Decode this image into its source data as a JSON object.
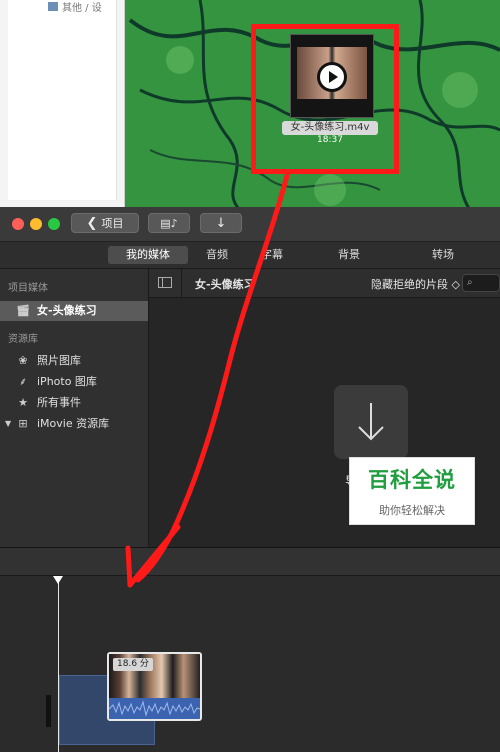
{
  "finder": {
    "top_text": "其他 / 设"
  },
  "desktop_file": {
    "name": "女-头像练习.m4v",
    "duration": "18:37"
  },
  "window": {
    "back_button": "项目",
    "back_icon": "chevron-left-icon",
    "media_icon": "film-music-icon",
    "import_icon": "arrow-down-icon"
  },
  "tabs": [
    "我的媒体",
    "音频",
    "字幕",
    "背景",
    "转场"
  ],
  "sidebar": {
    "section_project": "项目媒体",
    "project_item": "女-头像练习",
    "section_library": "资源库",
    "items": [
      {
        "label": "照片图库",
        "icon": "flower-icon"
      },
      {
        "label": "iPhoto 图库",
        "icon": "palm-icon"
      },
      {
        "label": "所有事件",
        "icon": "star-icon"
      },
      {
        "label": "iMovie 资源库",
        "icon": "grid-icon"
      }
    ]
  },
  "browser": {
    "title": "女-头像练习",
    "filter": "隐藏拒绝的片段 ◇",
    "search_icon": "search-icon",
    "import_label": "导入媒体"
  },
  "timeline": {
    "clip_duration": "18.6 分"
  },
  "watermark": {
    "title": "百科全说",
    "subtitle": "助你轻松解决"
  },
  "colors": {
    "annotation_red": "#ff1a1a",
    "selected_tab": "#4d4d4d",
    "clip_audio": "#3c63b0"
  }
}
